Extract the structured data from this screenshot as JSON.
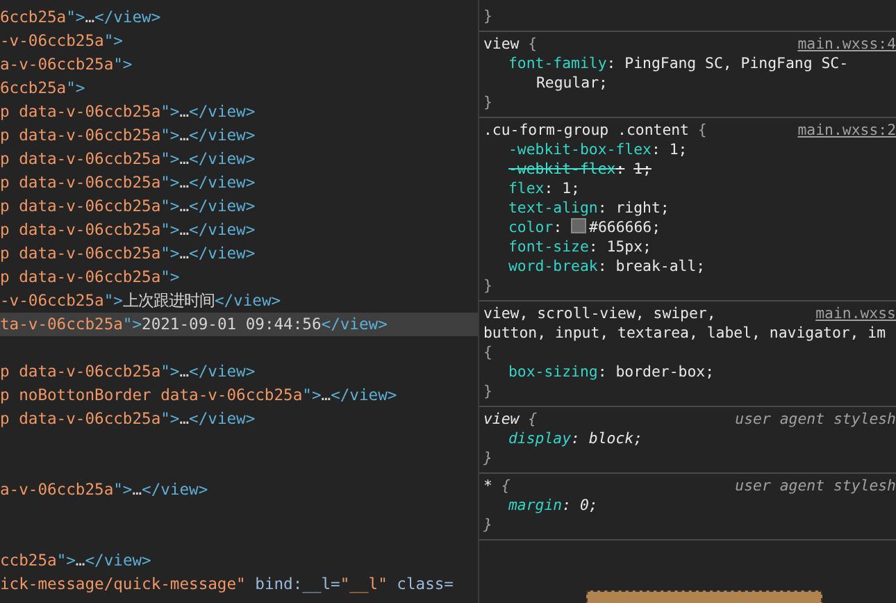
{
  "elements_panel": {
    "lines": [
      {
        "selected": false,
        "segments": [
          {
            "kind": "attr",
            "text": "6ccb25a"
          },
          {
            "kind": "tag",
            "text": "\">"
          },
          {
            "kind": "text",
            "text": "…"
          },
          {
            "kind": "tag",
            "text": "</view>"
          }
        ]
      },
      {
        "selected": false,
        "segments": [
          {
            "kind": "attr",
            "text": "-v-06ccb25a"
          },
          {
            "kind": "tag",
            "text": "\">"
          }
        ]
      },
      {
        "selected": false,
        "segments": [
          {
            "kind": "attr",
            "text": "a-v-06ccb25a"
          },
          {
            "kind": "tag",
            "text": "\">"
          }
        ]
      },
      {
        "selected": false,
        "segments": [
          {
            "kind": "attr",
            "text": "6ccb25a"
          },
          {
            "kind": "tag",
            "text": "\">"
          }
        ]
      },
      {
        "selected": false,
        "segments": [
          {
            "kind": "attr",
            "text": "p data-v-06ccb25a"
          },
          {
            "kind": "tag",
            "text": "\">"
          },
          {
            "kind": "text",
            "text": "…"
          },
          {
            "kind": "tag",
            "text": "</view>"
          }
        ]
      },
      {
        "selected": false,
        "segments": [
          {
            "kind": "attr",
            "text": "p data-v-06ccb25a"
          },
          {
            "kind": "tag",
            "text": "\">"
          },
          {
            "kind": "text",
            "text": "…"
          },
          {
            "kind": "tag",
            "text": "</view>"
          }
        ]
      },
      {
        "selected": false,
        "segments": [
          {
            "kind": "attr",
            "text": "p data-v-06ccb25a"
          },
          {
            "kind": "tag",
            "text": "\">"
          },
          {
            "kind": "text",
            "text": "…"
          },
          {
            "kind": "tag",
            "text": "</view>"
          }
        ]
      },
      {
        "selected": false,
        "segments": [
          {
            "kind": "attr",
            "text": "p data-v-06ccb25a"
          },
          {
            "kind": "tag",
            "text": "\">"
          },
          {
            "kind": "text",
            "text": "…"
          },
          {
            "kind": "tag",
            "text": "</view>"
          }
        ]
      },
      {
        "selected": false,
        "segments": [
          {
            "kind": "attr",
            "text": "p data-v-06ccb25a"
          },
          {
            "kind": "tag",
            "text": "\">"
          },
          {
            "kind": "text",
            "text": "…"
          },
          {
            "kind": "tag",
            "text": "</view>"
          }
        ]
      },
      {
        "selected": false,
        "segments": [
          {
            "kind": "attr",
            "text": "p data-v-06ccb25a"
          },
          {
            "kind": "tag",
            "text": "\">"
          },
          {
            "kind": "text",
            "text": "…"
          },
          {
            "kind": "tag",
            "text": "</view>"
          }
        ]
      },
      {
        "selected": false,
        "segments": [
          {
            "kind": "attr",
            "text": "p data-v-06ccb25a"
          },
          {
            "kind": "tag",
            "text": "\">"
          },
          {
            "kind": "text",
            "text": "…"
          },
          {
            "kind": "tag",
            "text": "</view>"
          }
        ]
      },
      {
        "selected": false,
        "segments": [
          {
            "kind": "attr",
            "text": "p data-v-06ccb25a"
          },
          {
            "kind": "tag",
            "text": "\">"
          }
        ]
      },
      {
        "selected": false,
        "segments": [
          {
            "kind": "attr",
            "text": "-v-06ccb25a"
          },
          {
            "kind": "tag",
            "text": "\">"
          },
          {
            "kind": "text",
            "text": "上次跟进时间"
          },
          {
            "kind": "tag",
            "text": "</view>"
          }
        ]
      },
      {
        "selected": true,
        "segments": [
          {
            "kind": "attr",
            "text": "ta-v-06ccb25a"
          },
          {
            "kind": "tag",
            "text": "\">"
          },
          {
            "kind": "text",
            "text": "2021-09-01 09:44:56"
          },
          {
            "kind": "tag",
            "text": "</view>"
          }
        ]
      },
      {
        "kind": "blank"
      },
      {
        "selected": false,
        "segments": [
          {
            "kind": "attr",
            "text": "p data-v-06ccb25a"
          },
          {
            "kind": "tag",
            "text": "\">"
          },
          {
            "kind": "text",
            "text": "…"
          },
          {
            "kind": "tag",
            "text": "</view>"
          }
        ]
      },
      {
        "selected": false,
        "segments": [
          {
            "kind": "attr",
            "text": "p noBottonBorder data-v-06ccb25a"
          },
          {
            "kind": "tag",
            "text": "\">"
          },
          {
            "kind": "text",
            "text": "…"
          },
          {
            "kind": "tag",
            "text": "</view>"
          }
        ]
      },
      {
        "selected": false,
        "segments": [
          {
            "kind": "attr",
            "text": "p data-v-06ccb25a"
          },
          {
            "kind": "tag",
            "text": "\">"
          },
          {
            "kind": "text",
            "text": "…"
          },
          {
            "kind": "tag",
            "text": "</view>"
          }
        ]
      },
      {
        "kind": "blank"
      },
      {
        "kind": "blank"
      },
      {
        "selected": false,
        "segments": [
          {
            "kind": "attr",
            "text": "a-v-06ccb25a"
          },
          {
            "kind": "tag",
            "text": "\">"
          },
          {
            "kind": "text",
            "text": "…"
          },
          {
            "kind": "tag",
            "text": "</view>"
          }
        ]
      },
      {
        "kind": "blank"
      },
      {
        "kind": "blank"
      },
      {
        "selected": false,
        "segments": [
          {
            "kind": "attr",
            "text": "ccb25a"
          },
          {
            "kind": "tag",
            "text": "\">"
          },
          {
            "kind": "text",
            "text": "…"
          },
          {
            "kind": "tag",
            "text": "</view>"
          }
        ]
      },
      {
        "selected": false,
        "segments": [
          {
            "kind": "attr",
            "text": "ick-message/quick-message\""
          },
          {
            "kind": "attrname",
            "text": " bind:__l="
          },
          {
            "kind": "attr",
            "text": "\"__l\""
          },
          {
            "kind": "attrname",
            "text": " class="
          }
        ]
      }
    ]
  },
  "styles_panel": {
    "leading_brace": "}",
    "rules": [
      {
        "selector_lines": [
          "view"
        ],
        "kind": "author",
        "open_brace": "{",
        "close_brace": "}",
        "source": "main.wxss:4",
        "properties": [
          {
            "name": "font-family",
            "colon": ":",
            "value_lines": [
              "PingFang SC, PingFang SC-",
              "Regular;"
            ],
            "struck": false
          }
        ]
      },
      {
        "selector_lines": [
          ".cu-form-group .content"
        ],
        "kind": "author",
        "open_brace": "{",
        "close_brace": "}",
        "source": "main.wxss:2",
        "properties": [
          {
            "name": "-webkit-box-flex",
            "colon": ":",
            "value_lines": [
              "1;"
            ],
            "struck": false
          },
          {
            "name": "-webkit-flex",
            "colon": ":",
            "value_lines": [
              "1;"
            ],
            "struck": true
          },
          {
            "name": "flex",
            "colon": ":",
            "value_lines": [
              "1;"
            ],
            "struck": false
          },
          {
            "name": "text-align",
            "colon": ":",
            "value_lines": [
              "right;"
            ],
            "struck": false
          },
          {
            "name": "color",
            "colon": ":",
            "value_lines": [
              "#666666;"
            ],
            "struck": false,
            "color": "#666666"
          },
          {
            "name": "font-size",
            "colon": ":",
            "value_lines": [
              "15px;"
            ],
            "struck": false
          },
          {
            "name": "word-break",
            "colon": ":",
            "value_lines": [
              "break-all;"
            ],
            "struck": false
          }
        ]
      },
      {
        "selector_lines": [
          "view, scroll-view, swiper,",
          "button, input, textarea, label, navigator, im"
        ],
        "kind": "author",
        "open_brace": "{",
        "close_brace": "}",
        "source": "main.wxss",
        "properties": [
          {
            "name": "box-sizing",
            "colon": ":",
            "value_lines": [
              "border-box;"
            ],
            "struck": false
          }
        ]
      },
      {
        "selector_lines": [
          "view"
        ],
        "kind": "user-agent",
        "open_brace": "{",
        "close_brace": "}",
        "source": "user agent stylesh",
        "properties": [
          {
            "name": "display",
            "colon": ":",
            "value_lines": [
              "block;"
            ],
            "struck": false
          }
        ]
      },
      {
        "selector_lines": [
          "*"
        ],
        "kind": "user-agent",
        "open_brace": "{",
        "close_brace": "}",
        "source": "user agent stylesh",
        "properties": [
          {
            "name": "margin",
            "colon": ":",
            "value_lines": [
              "0;"
            ],
            "struck": false
          }
        ]
      }
    ]
  }
}
